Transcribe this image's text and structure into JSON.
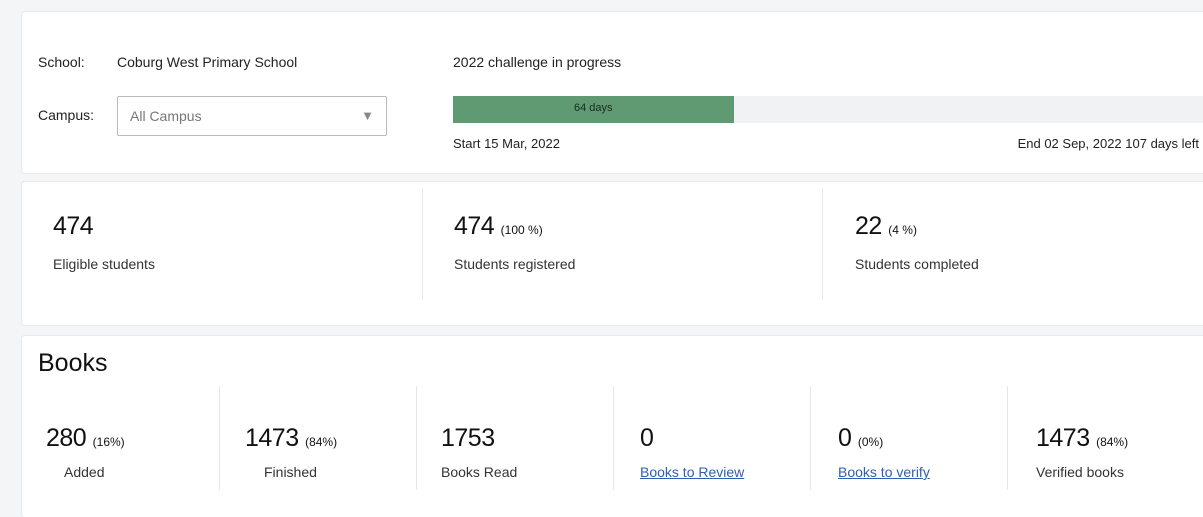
{
  "challenge": {
    "school_label": "School:",
    "school_name": "Coburg West Primary School",
    "campus_label": "Campus:",
    "campus_selected": "All Campus",
    "status": "2022 challenge in progress",
    "progress_label": "64 days",
    "progress_fraction": 0.374,
    "start_label": "Start 15 Mar, 2022",
    "end_label": "End 02 Sep, 2022 107 days left"
  },
  "stats": [
    {
      "value": "474",
      "pct": "",
      "caption": "Eligible students"
    },
    {
      "value": "474",
      "pct": "(100 %)",
      "caption": "Students registered"
    },
    {
      "value": "22",
      "pct": "(4 %)",
      "caption": "Students completed"
    }
  ],
  "books": {
    "title": "Books",
    "items": [
      {
        "value": "280",
        "pct": "(16%)",
        "caption": "Added"
      },
      {
        "value": "1473",
        "pct": "(84%)",
        "caption": "Finished"
      },
      {
        "value": "1753",
        "pct": "",
        "caption": "Books Read"
      },
      {
        "value": "0",
        "pct": "",
        "caption": "Books to Review"
      },
      {
        "value": "0",
        "pct": "(0%)",
        "caption": "Books to verify"
      },
      {
        "value": "1473",
        "pct": "(84%)",
        "caption": "Verified books"
      }
    ]
  }
}
